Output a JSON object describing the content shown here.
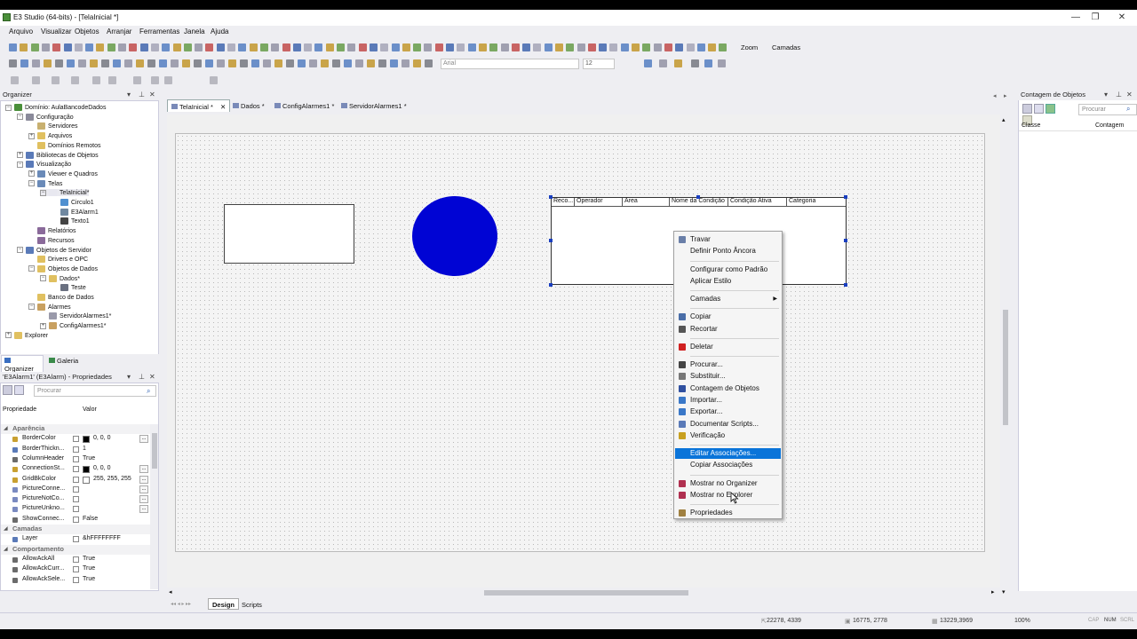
{
  "window": {
    "title": "E3 Studio (64-bits) - [TelaInicial *]",
    "minimize": "—",
    "restore": "❐",
    "close": "✕"
  },
  "menu": [
    "Arquivo",
    "Visualizar",
    "Objetos",
    "Arranjar",
    "Ferramentas",
    "Janela",
    "Ajuda"
  ],
  "toolbar": {
    "zoom_label": "Zoom",
    "layers_label": "Camadas",
    "font_name": "Arial",
    "font_size": "12"
  },
  "organizer": {
    "title": "Organizer",
    "tree": [
      {
        "label": "Domínio: AulaBancodeDados",
        "expander": "⊟"
      },
      {
        "label": "Configuração",
        "expander": "⊟"
      },
      {
        "label": "Servidores",
        "expander": ""
      },
      {
        "label": "Arquivos",
        "expander": "⊞"
      },
      {
        "label": "Domínios Remotos",
        "expander": ""
      },
      {
        "label": "Bibliotecas de Objetos",
        "expander": "⊞"
      },
      {
        "label": "Visualização",
        "expander": "⊟"
      },
      {
        "label": "Viewer e Quadros",
        "expander": "⊞"
      },
      {
        "label": "Telas",
        "expander": "⊟"
      },
      {
        "label": "TelaInicial*",
        "expander": "⊟"
      },
      {
        "label": "Circulo1",
        "expander": ""
      },
      {
        "label": "E3Alarm1",
        "expander": ""
      },
      {
        "label": "Texto1",
        "expander": ""
      },
      {
        "label": "Relatórios",
        "expander": ""
      },
      {
        "label": "Recursos",
        "expander": ""
      },
      {
        "label": "Objetos de Servidor",
        "expander": "⊟"
      },
      {
        "label": "Drivers e OPC",
        "expander": ""
      },
      {
        "label": "Objetos de Dados",
        "expander": "⊟"
      },
      {
        "label": "Dados*",
        "expander": "⊟"
      },
      {
        "label": "Teste",
        "expander": ""
      },
      {
        "label": "Banco de Dados",
        "expander": ""
      },
      {
        "label": "Alarmes",
        "expander": "⊟"
      },
      {
        "label": "ServidorAlarmes1*",
        "expander": ""
      },
      {
        "label": "ConfigAlarmes1*",
        "expander": "⊞"
      },
      {
        "label": "Explorer",
        "expander": "⊞"
      }
    ],
    "tabs": [
      "Organizer",
      "Galeria"
    ]
  },
  "properties": {
    "title": "'E3Alarm1' (E3Alarm) - Propriedades",
    "search_placeholder": "Procurar",
    "col_property": "Propriedade",
    "col_value": "Valor",
    "rows": [
      {
        "type": "cat",
        "name": "Aparência"
      },
      {
        "type": "prop",
        "name": "BorderColor",
        "value": "0, 0, 0",
        "swatch": "#000000",
        "ell": "..."
      },
      {
        "type": "prop",
        "name": "BorderThickn...",
        "value": "1"
      },
      {
        "type": "prop",
        "name": "ColumnHeader",
        "value": "True"
      },
      {
        "type": "prop",
        "name": "ConnectionSt...",
        "value": "0, 0, 0",
        "swatch": "#000000",
        "ell": "..."
      },
      {
        "type": "prop",
        "name": "GridBkColor",
        "value": "255, 255, 255",
        "swatch": "#ffffff",
        "ell": "..."
      },
      {
        "type": "prop",
        "name": "PictureConne...",
        "value": "",
        "ell": "..."
      },
      {
        "type": "prop",
        "name": "PictureNotCo...",
        "value": "",
        "ell": "..."
      },
      {
        "type": "prop",
        "name": "PictureUnkno...",
        "value": "",
        "ell": "..."
      },
      {
        "type": "prop",
        "name": "ShowConnec...",
        "value": "False"
      },
      {
        "type": "cat",
        "name": "Camadas"
      },
      {
        "type": "prop",
        "name": "Layer",
        "value": "&hFFFFFFFF"
      },
      {
        "type": "cat",
        "name": "Comportamento"
      },
      {
        "type": "prop",
        "name": "AllowAckAll",
        "value": "True"
      },
      {
        "type": "prop",
        "name": "AllowAckCurr...",
        "value": "True"
      },
      {
        "type": "prop",
        "name": "AllowAckSele...",
        "value": "True"
      }
    ]
  },
  "doc_tabs": [
    {
      "label": "TelaInicial *",
      "active": true,
      "close": "✕"
    },
    {
      "label": "Dados *",
      "active": false
    },
    {
      "label": "ConfigAlarmes1 *",
      "active": false
    },
    {
      "label": "ServidorAlarmes1 *",
      "active": false
    }
  ],
  "alarm_columns": [
    "Reco...",
    "Operador",
    "Área",
    "Nome da Condição",
    "Condição Ativa",
    "Categoria"
  ],
  "context_menu": [
    {
      "label": "Travar",
      "icon": "lock-icon",
      "color": "#6a7fa8"
    },
    {
      "label": "Definir Ponto Âncora"
    },
    {
      "sep": true
    },
    {
      "label": "Configurar como Padrão"
    },
    {
      "label": "Aplicar Estilo"
    },
    {
      "sep": true
    },
    {
      "label": "Camadas",
      "submenu": "▶"
    },
    {
      "sep": true
    },
    {
      "label": "Copiar",
      "icon": "copy-icon",
      "color": "#4a6ea8"
    },
    {
      "label": "Recortar",
      "icon": "scissors-icon",
      "color": "#555555"
    },
    {
      "sep": true
    },
    {
      "label": "Deletar",
      "icon": "delete-icon",
      "color": "#d02020"
    },
    {
      "sep": true
    },
    {
      "label": "Procurar...",
      "icon": "binoculars-icon",
      "color": "#444444"
    },
    {
      "label": "Substituir...",
      "icon": "replace-icon",
      "color": "#777777"
    },
    {
      "label": "Contagem de Objetos",
      "icon": "sigma-icon",
      "color": "#3050a0"
    },
    {
      "label": "Importar...",
      "icon": "import-icon",
      "color": "#3a78c8"
    },
    {
      "label": "Exportar...",
      "icon": "export-icon",
      "color": "#3a78c8"
    },
    {
      "label": "Documentar Scripts...",
      "icon": "document-icon",
      "color": "#5a7ab8"
    },
    {
      "label": "Verificação",
      "icon": "verify-icon",
      "color": "#c8a020"
    },
    {
      "sep": true
    },
    {
      "label": "Editar Associações...",
      "highlight": true
    },
    {
      "label": "Copiar Associações"
    },
    {
      "sep": true
    },
    {
      "label": "Mostrar no Organizer",
      "icon": "organizer-icon",
      "color": "#b03050"
    },
    {
      "label": "Mostrar no Explorer",
      "icon": "explorer-icon",
      "color": "#b03050"
    },
    {
      "sep": true
    },
    {
      "label": "Propriedades",
      "icon": "properties-icon",
      "color": "#a08040"
    }
  ],
  "count_panel": {
    "title": "Contagem de Objetos",
    "search_placeholder": "Procurar",
    "col_class": "Classe",
    "col_count": "Contagem"
  },
  "bottom_tabs": [
    "Design",
    "Scripts"
  ],
  "status": {
    "cursor": "22278, 4339",
    "position": "16775, 2778",
    "size": "13229,3969",
    "zoom": "100%",
    "cap": "CAP",
    "num": "NUM",
    "scrl": "SCRL"
  }
}
